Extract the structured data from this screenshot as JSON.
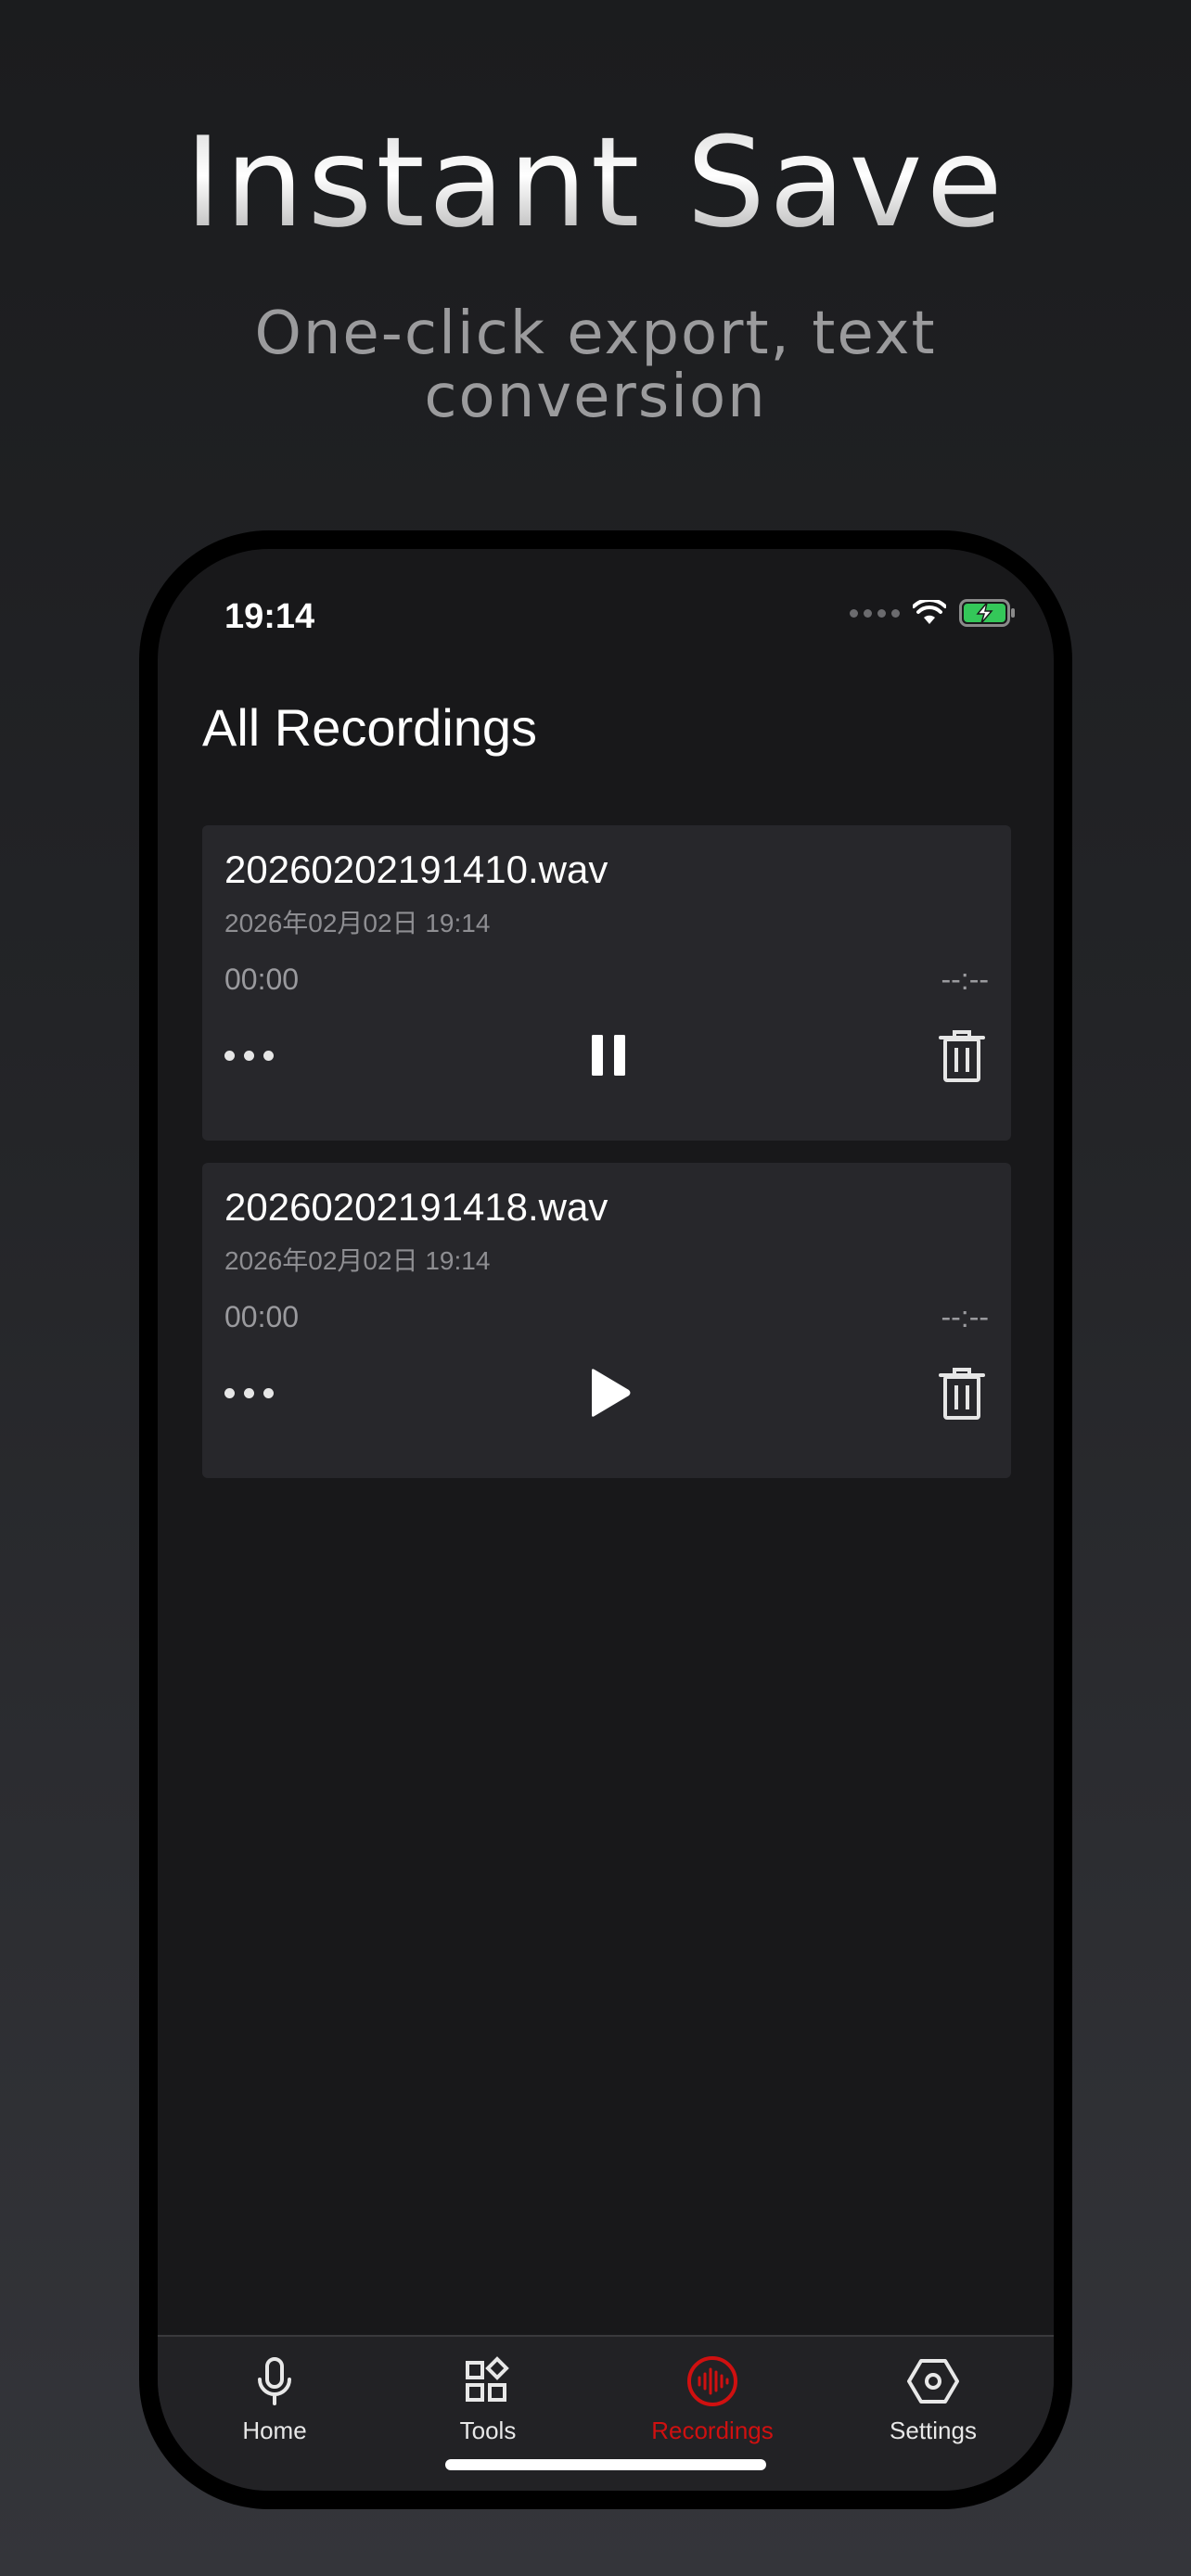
{
  "hero": {
    "title": "Instant Save",
    "subtitle": "One-click export, text conversion"
  },
  "status_bar": {
    "time": "19:14",
    "icons": [
      "cellular-signal-icon",
      "wifi-icon",
      "battery-charging-icon"
    ],
    "battery_color": "#34c759"
  },
  "page": {
    "title": "All Recordings"
  },
  "recordings": [
    {
      "filename": "20260202191410.wav",
      "date": "2026年02月02日 19:14",
      "current_time": "00:00",
      "total_time": "--:--",
      "state": "playing",
      "control_icon": "pause-icon"
    },
    {
      "filename": "20260202191418.wav",
      "date": "2026年02月02日 19:14",
      "current_time": "00:00",
      "total_time": "--:--",
      "state": "paused",
      "control_icon": "play-icon"
    }
  ],
  "tabbar": {
    "active": "Recordings",
    "accent_color": "#d01010",
    "tabs": [
      {
        "label": "Home",
        "icon": "microphone-icon"
      },
      {
        "label": "Tools",
        "icon": "tools-grid-icon"
      },
      {
        "label": "Recordings",
        "icon": "recordings-waveform-icon"
      },
      {
        "label": "Settings",
        "icon": "settings-hexagon-icon"
      }
    ]
  }
}
